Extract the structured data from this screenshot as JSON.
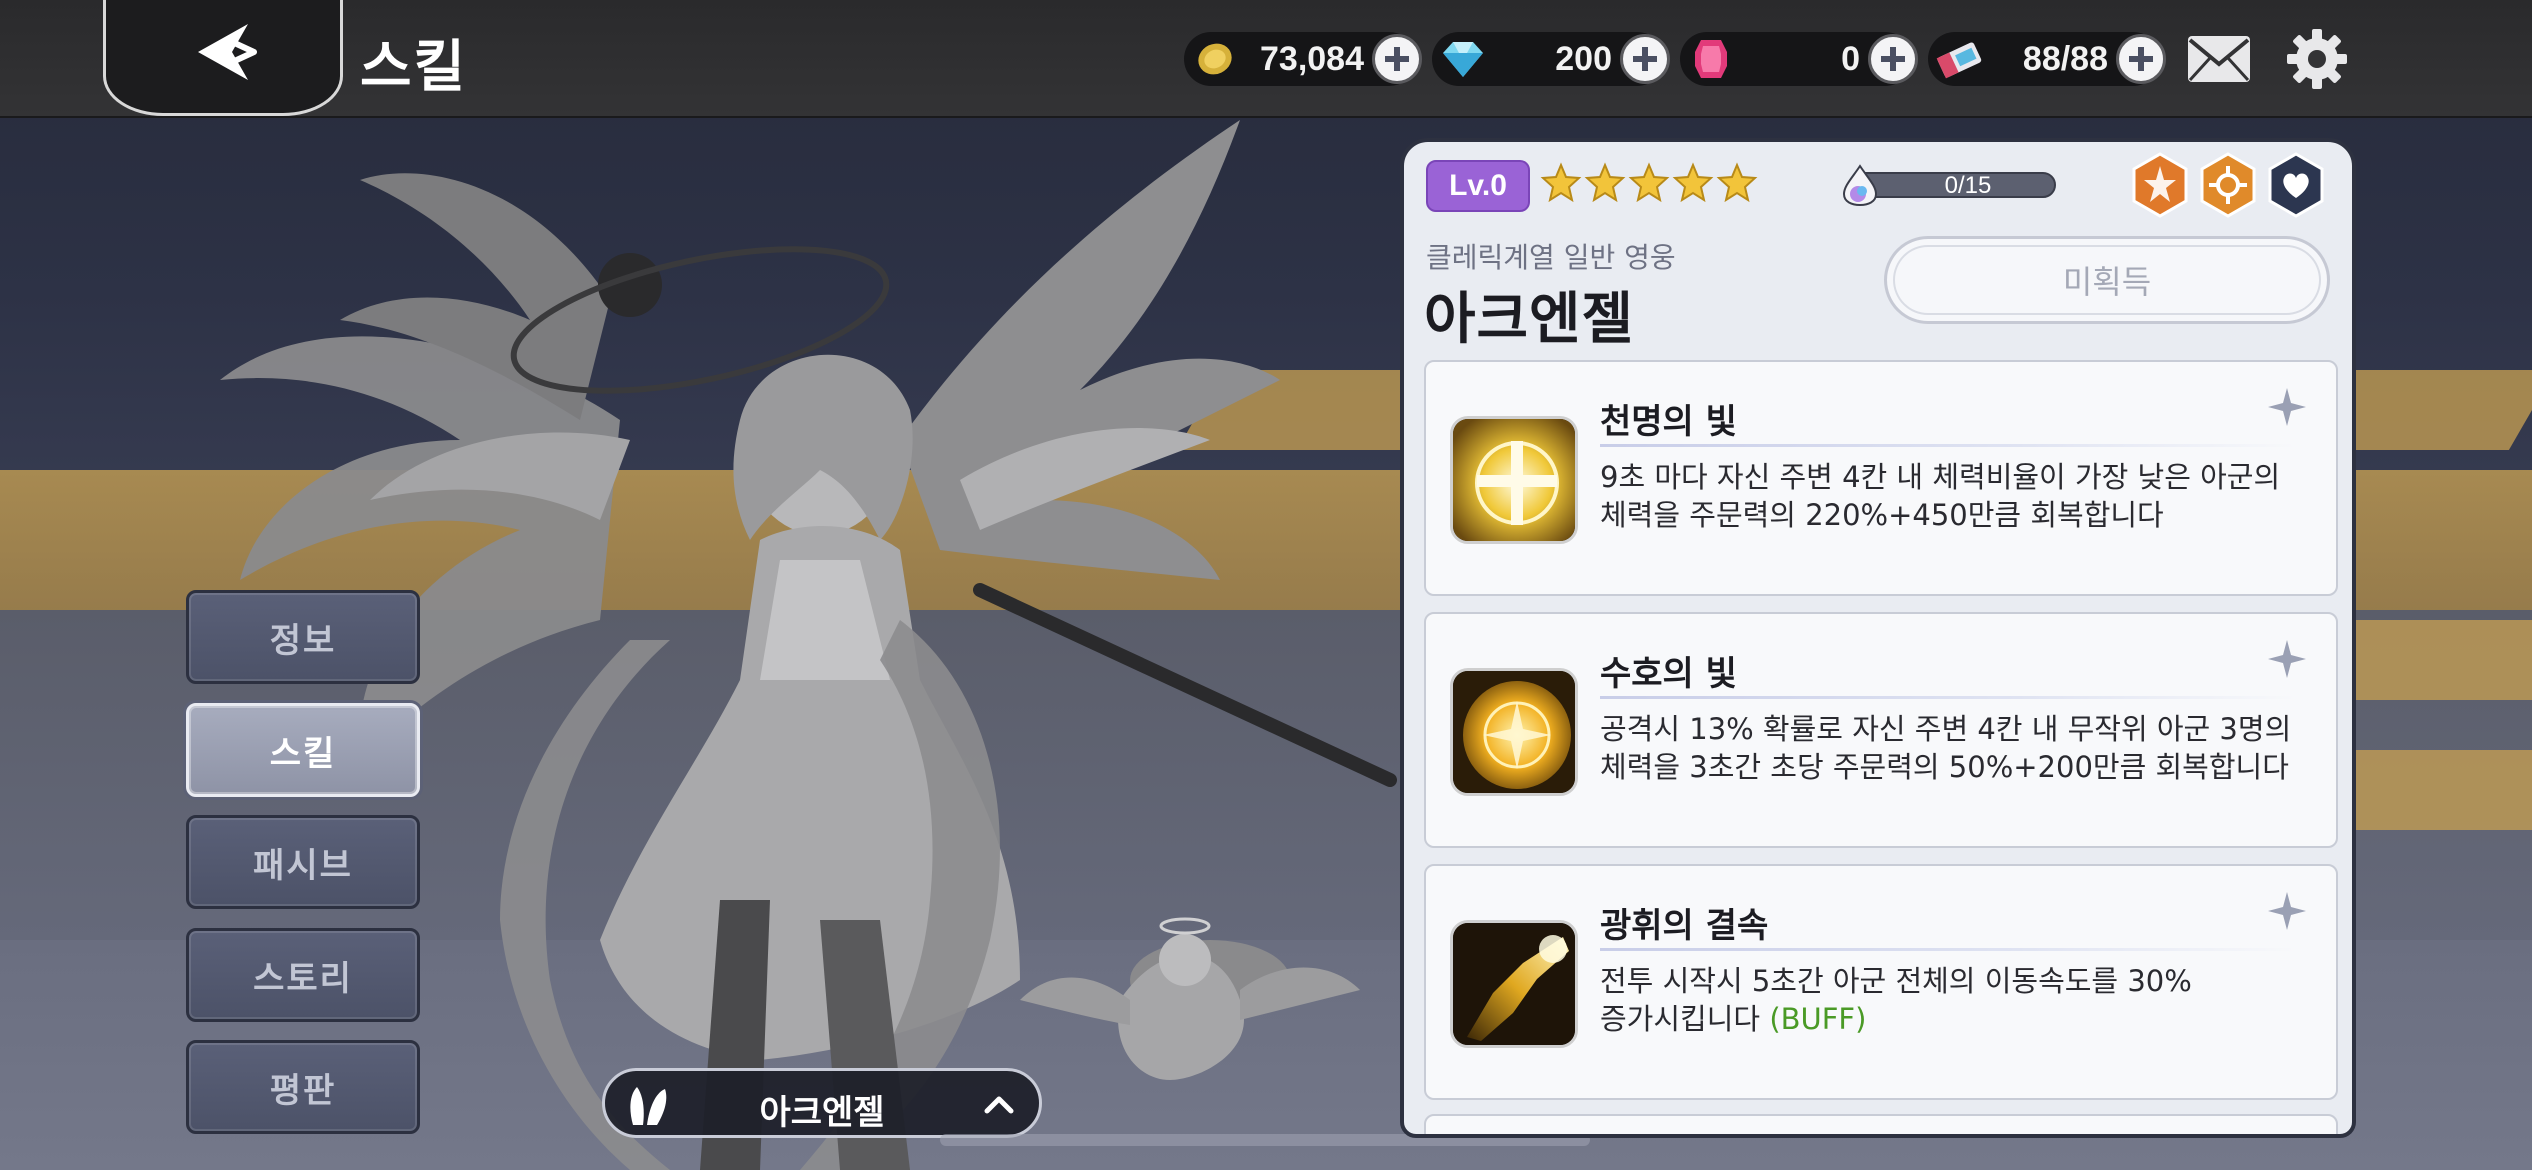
{
  "topbar": {
    "title": "스킬",
    "currencies": [
      {
        "name": "gold",
        "value": "73,084",
        "icon": "gold-coin-icon"
      },
      {
        "name": "diamond",
        "value": "200",
        "icon": "diamond-icon"
      },
      {
        "name": "ruby",
        "value": "0",
        "icon": "ruby-gem-icon"
      },
      {
        "name": "stamina",
        "value": "88/88",
        "icon": "ticket-icon"
      }
    ]
  },
  "tabs": [
    {
      "label": "정보",
      "active": false
    },
    {
      "label": "스킬",
      "active": true
    },
    {
      "label": "패시브",
      "active": false
    },
    {
      "label": "스토리",
      "active": false
    },
    {
      "label": "평판",
      "active": false
    }
  ],
  "character_selector": {
    "name": "아크엔젤"
  },
  "panel": {
    "level": "Lv.0",
    "stars": 5,
    "exp": "0/15",
    "hero_class": "클레릭계열 일반 영웅",
    "hero_name": "아크엔젤",
    "unacquired_label": "미획득",
    "skills": [
      {
        "name": "천명의 빛",
        "desc_line1": "9초 마다 자신 주변 4칸 내 체력비율이 가장 낮은 아군의",
        "desc_line2": "체력을 주문력의 220%+450만큼 회복합니다",
        "buff": ""
      },
      {
        "name": "수호의 빛",
        "desc_line1": "공격시 13% 확률로 자신 주변 4칸 내 무작위 아군 3명의",
        "desc_line2": "체력을 3초간 초당 주문력의 50%+200만큼 회복합니다",
        "buff": ""
      },
      {
        "name": "광휘의 결속",
        "desc_line1": "전투 시작시 5초간 아군 전체의 이동속도를 30%",
        "desc_line2": "증가시킵니다 ",
        "buff": "(BUFF)"
      }
    ]
  },
  "colors": {
    "level_badge": "#9a63d6",
    "buff_text": "#4a9a26",
    "class_icon_orange": "#e0792a",
    "class_icon_navy": "#2c3650"
  }
}
